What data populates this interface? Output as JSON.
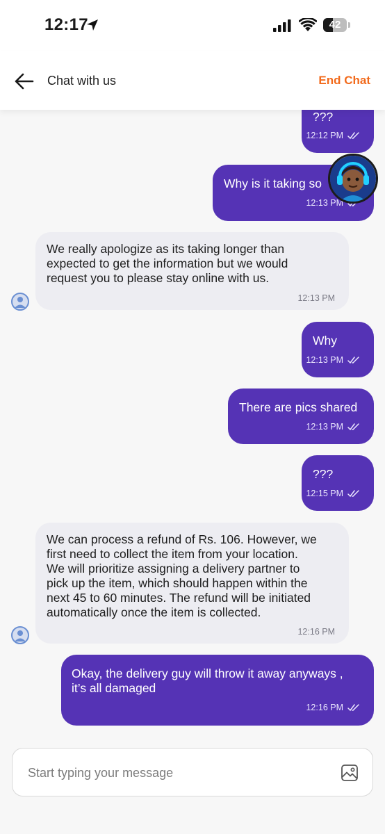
{
  "status_bar": {
    "time": "12:17",
    "battery": "42",
    "battery_level": 0.42
  },
  "header": {
    "title": "Chat with us",
    "end_chat_label": "End Chat"
  },
  "messages": [
    {
      "text": "???",
      "time": "12:12 PM"
    },
    {
      "text": "Why is it taking so",
      "time": "12:13 PM"
    },
    {
      "text": "We really apologize as its taking longer than\nexpected to get the information but we would\nrequest you to please stay online with us.",
      "time": "12:13 PM"
    },
    {
      "text": "Why",
      "time": "12:13 PM"
    },
    {
      "text": "There are pics shared",
      "time": "12:13 PM"
    },
    {
      "text": "???",
      "time": "12:15 PM"
    },
    {
      "text": "We can process a refund of Rs. 106. However, we\nfirst need to collect the item from your location.\nWe will prioritize assigning a delivery partner to\npick up the item, which should happen within the\nnext 45 to 60 minutes. The refund will be initiated\nautomatically once the item is collected.",
      "time": "12:16 PM"
    },
    {
      "text": "Okay, the delivery guy will throw it away anyways ,\nit’s all damaged",
      "time": "12:16 PM"
    }
  ],
  "composer": {
    "placeholder": "Start typing your message"
  },
  "colors": {
    "accent": "#5533b5",
    "end_chat": "#f26a1b",
    "incoming_bg": "#ededf2"
  }
}
